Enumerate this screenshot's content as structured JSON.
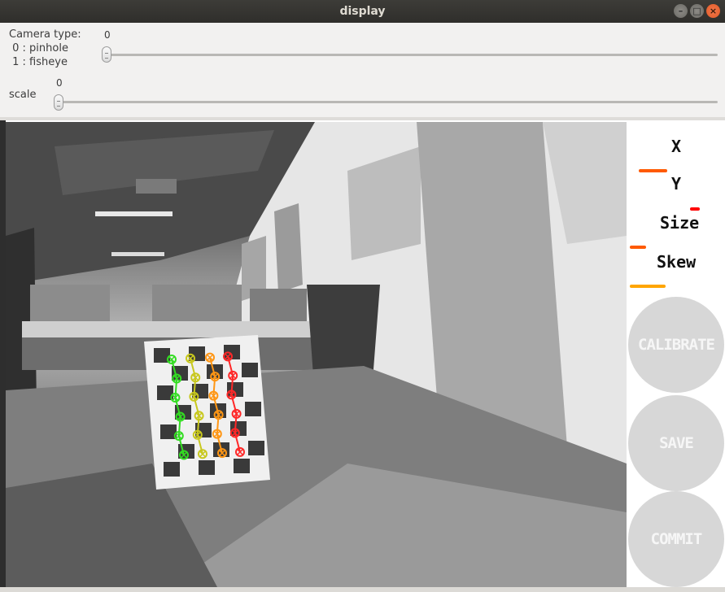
{
  "window": {
    "title": "display"
  },
  "controls": {
    "camera_type": {
      "label": "Camera type:\n 0 : pinhole\n 1 : fisheye",
      "value": "0",
      "level": 0
    },
    "scale": {
      "label": "scale",
      "value": "0",
      "level": 0
    }
  },
  "metrics": [
    {
      "label": "X",
      "bar_color": "#ff5a00",
      "progress": 0.3
    },
    {
      "label": "Y",
      "bar_color": "#ff0000",
      "progress": 0.1
    },
    {
      "label": "Size",
      "bar_color": "#ff5a00",
      "progress": 0.17
    },
    {
      "label": "Skew",
      "bar_color": "#ffa500",
      "progress": 0.38
    }
  ],
  "buttons": {
    "calibrate": "CALIBRATE",
    "save": "SAVE",
    "commit": "COMMIT"
  },
  "colors": {
    "button_bg": "#d7d7d7",
    "button_text": "#f6f6f6",
    "detected_corners": [
      "#33dd22",
      "#c8c81e",
      "#ff9614",
      "#ff2828"
    ]
  }
}
